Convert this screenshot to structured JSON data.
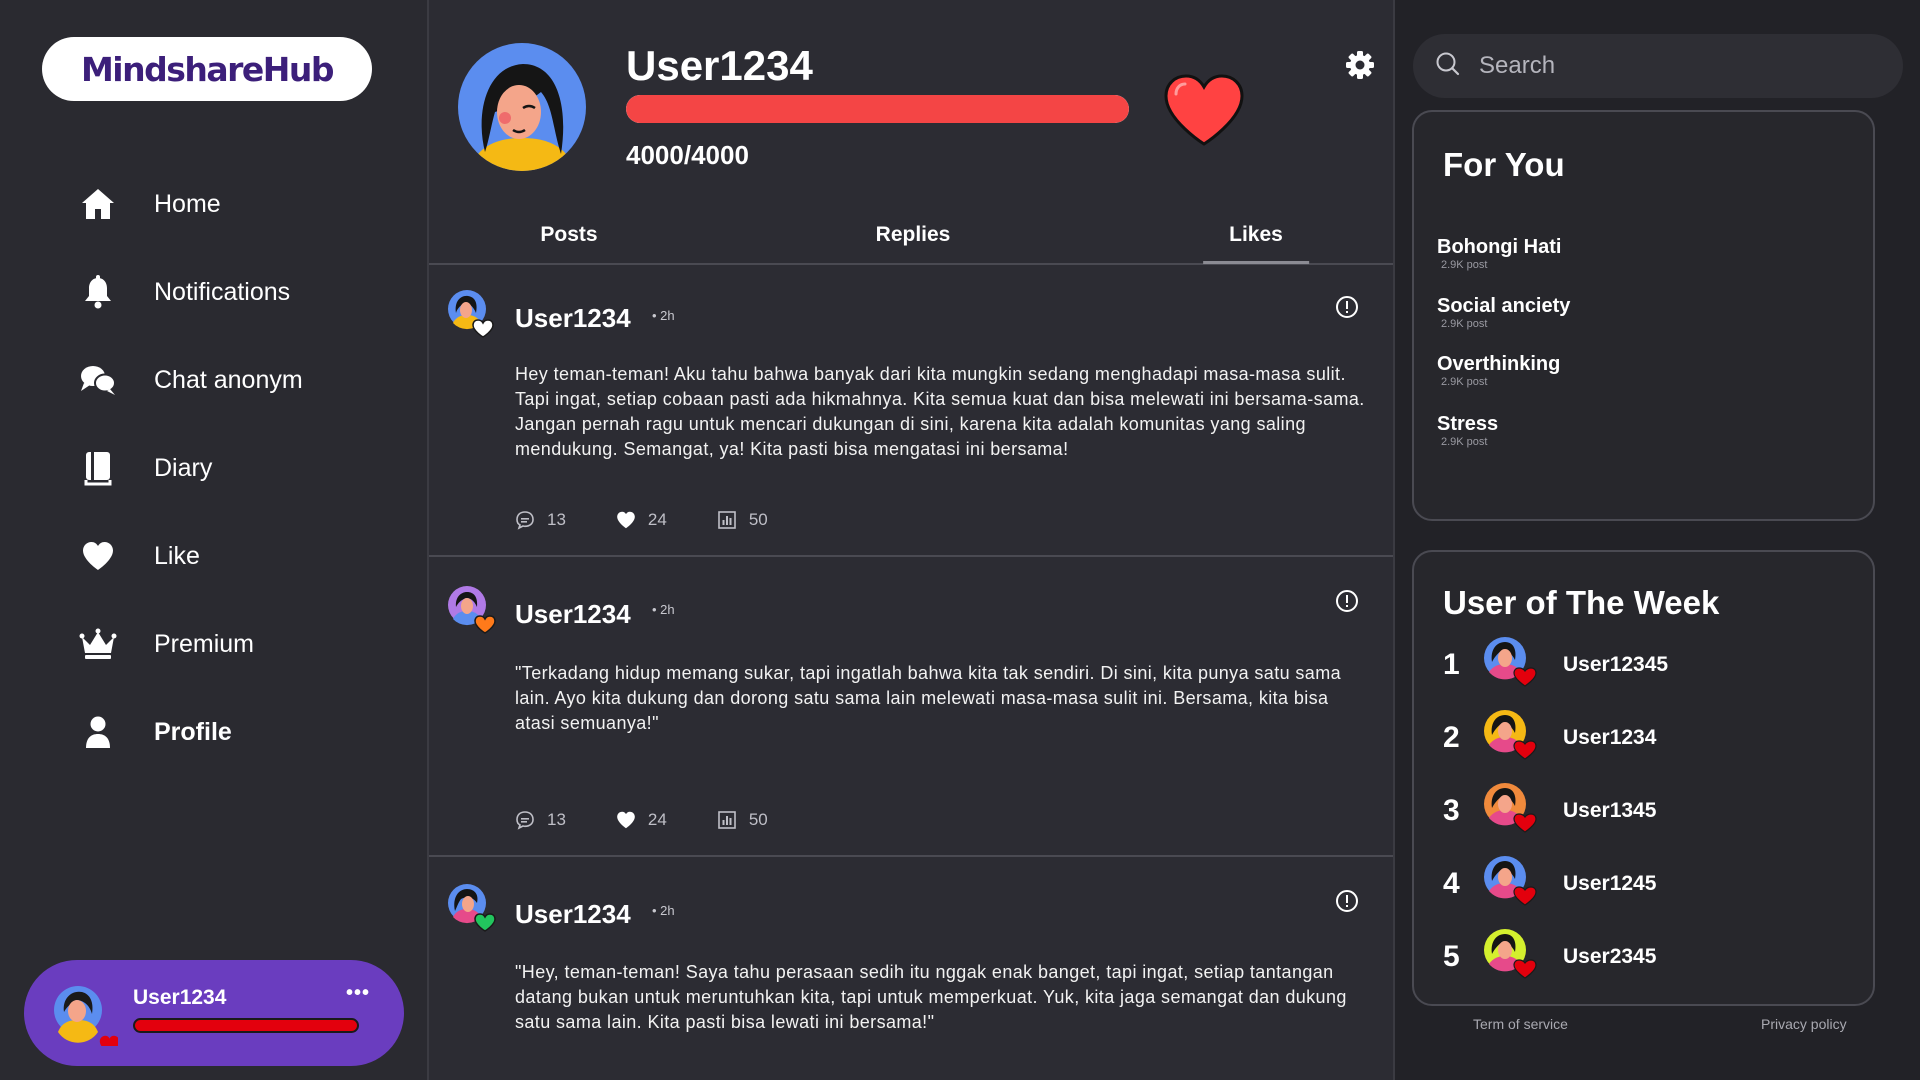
{
  "app": {
    "logo_text": "MindshareHub"
  },
  "sidebar": {
    "items": [
      {
        "label": "Home",
        "icon": "home-icon"
      },
      {
        "label": "Notifications",
        "icon": "bell-icon"
      },
      {
        "label": "Chat anonym",
        "icon": "chat-icon"
      },
      {
        "label": "Diary",
        "icon": "diary-icon"
      },
      {
        "label": "Like",
        "icon": "heart-icon"
      },
      {
        "label": "Premium",
        "icon": "crown-icon"
      },
      {
        "label": "Profile",
        "icon": "user-icon"
      }
    ],
    "active": "Profile",
    "current_user": {
      "name": "User1234",
      "more_label": "•••"
    }
  },
  "profile": {
    "name": "User1234",
    "hp_text": "4000/4000",
    "hp_fraction": 1.0,
    "hp_color": "#f44545"
  },
  "tabs": [
    {
      "label": "Posts"
    },
    {
      "label": "Replies"
    },
    {
      "label": "Likes"
    }
  ],
  "active_tab": "Likes",
  "posts": [
    {
      "user": "User1234",
      "time": "• 2h",
      "body": "Hey teman-teman! Aku tahu bahwa banyak dari kita mungkin sedang menghadapi masa-masa sulit. Tapi ingat, setiap cobaan pasti ada hikmahnya. Kita semua kuat dan bisa melewati ini bersama-sama. Jangan pernah ragu untuk mencari dukungan di sini, karena kita adalah komunitas yang saling mendukung. Semangat, ya! Kita pasti bisa mengatasi ini bersama!",
      "comments": "13",
      "likes": "24",
      "views": "50",
      "badge_color": "#ffffff"
    },
    {
      "user": "User1234",
      "time": "• 2h",
      "body": "\"Terkadang hidup memang sukar, tapi ingatlah bahwa kita tak sendiri. Di sini, kita punya satu sama lain. Ayo kita dukung dan dorong satu sama lain melewati masa-masa sulit ini. Bersama, kita bisa atasi semuanya!\"",
      "comments": "13",
      "likes": "24",
      "views": "50",
      "badge_color": "#ff7a1a"
    },
    {
      "user": "User1234",
      "time": "• 2h",
      "body": "\"Hey, teman-teman! Saya tahu perasaan sedih itu nggak enak banget, tapi ingat, setiap tantangan datang bukan untuk meruntuhkan kita, tapi untuk memperkuat. Yuk, kita jaga semangat dan dukung satu sama lain. Kita pasti bisa lewati ini bersama!\"",
      "comments": "",
      "likes": "",
      "views": "",
      "badge_color": "#22c55e"
    }
  ],
  "search": {
    "placeholder": "Search"
  },
  "for_you": {
    "title": "For You",
    "topics": [
      {
        "name": "Bohongi Hati",
        "count": "2.9K  post"
      },
      {
        "name": "Social anciety",
        "count": "2.9K  post"
      },
      {
        "name": "Overthinking",
        "count": "2.9K  post"
      },
      {
        "name": "Stress",
        "count": "2.9K  post"
      }
    ]
  },
  "user_of_week": {
    "title": "User of The Week",
    "ranks": [
      {
        "rank": "1",
        "name": "User12345",
        "avatar_color": "#5b8def"
      },
      {
        "rank": "2",
        "name": "User1234",
        "avatar_color": "#f5b914"
      },
      {
        "rank": "3",
        "name": "User1345",
        "avatar_color": "#f08a3c"
      },
      {
        "rank": "4",
        "name": "User1245",
        "avatar_color": "#5b8def"
      },
      {
        "rank": "5",
        "name": "User2345",
        "avatar_color": "#d4f02e"
      }
    ]
  },
  "footer": {
    "terms": "Term of service",
    "privacy": "Privacy policy"
  },
  "colors": {
    "accent_purple": "#6a3dbf",
    "heart_red": "#e3000d",
    "logo_text": "#3c1f7a"
  }
}
